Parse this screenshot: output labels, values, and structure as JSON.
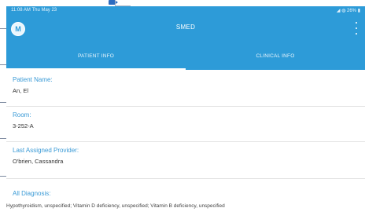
{
  "status": {
    "time": "11:08 AM  Thu May 23",
    "indicators": "◢ ◍ 26% ▮"
  },
  "app": {
    "title": "SMED",
    "logo_letter": "M"
  },
  "tabs": [
    {
      "label": "PATIENT INFO",
      "active": true
    },
    {
      "label": "CLINICAL INFO",
      "active": false
    }
  ],
  "patient": {
    "name_label": "Patient Name:",
    "name_value": "An, El",
    "room_label": "Room:",
    "room_value": "3-252-A",
    "provider_label": "Last Assigned Provider:",
    "provider_value": "O'brien, Cassandra",
    "diagnosis_label": "All Diagnosis:",
    "diagnosis_value": "Hypothyroidism, unspecified; Vitamin D deficiency, unspecified; Vitamin B deficiency, unspecified"
  },
  "colors": {
    "brand": "#2d9bd8",
    "label": "#3a9ad6"
  }
}
